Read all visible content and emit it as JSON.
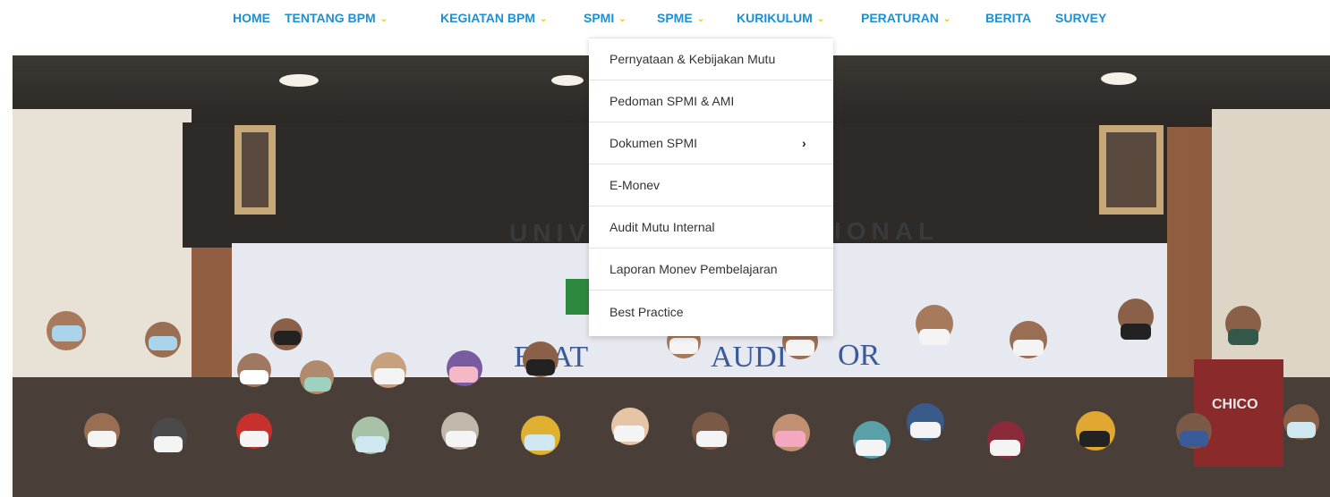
{
  "nav": {
    "items": [
      {
        "label": "HOME",
        "dropdown": false
      },
      {
        "label": "TENTANG BPM",
        "dropdown": true
      },
      {
        "label": "KEGIATAN BPM",
        "dropdown": true
      },
      {
        "label": "SPMI",
        "dropdown": true
      },
      {
        "label": "SPME",
        "dropdown": true
      },
      {
        "label": "KURIKULUM",
        "dropdown": true
      },
      {
        "label": "PERATURAN",
        "dropdown": true
      },
      {
        "label": "BERITA",
        "dropdown": false
      },
      {
        "label": "SURVEY",
        "dropdown": false
      }
    ],
    "chevron_glyph": "⌄",
    "colors": {
      "link": "#1e8fd0",
      "chevron": "#f4c90c"
    }
  },
  "spmi_menu": {
    "items": [
      {
        "label": "Pernyataan & Kebijakan Mutu",
        "submenu": false
      },
      {
        "label": "Pedoman SPMI & AMI",
        "submenu": false
      },
      {
        "label": "Dokumen SPMI",
        "submenu": true
      },
      {
        "label": "E-Monev",
        "submenu": false
      },
      {
        "label": "Audit Mutu Internal",
        "submenu": false
      },
      {
        "label": "Laporan Monev Pembelajaran",
        "submenu": false
      },
      {
        "label": "Best Practice",
        "submenu": false
      }
    ],
    "submenu_glyph": "›"
  },
  "hero": {
    "banner_left": "UNIV",
    "banner_right": "IONAL",
    "subtitle_left": "ELAT",
    "subtitle_mid": "AUDI",
    "subtitle_right": "OR",
    "sweater_text": "CHICO"
  }
}
